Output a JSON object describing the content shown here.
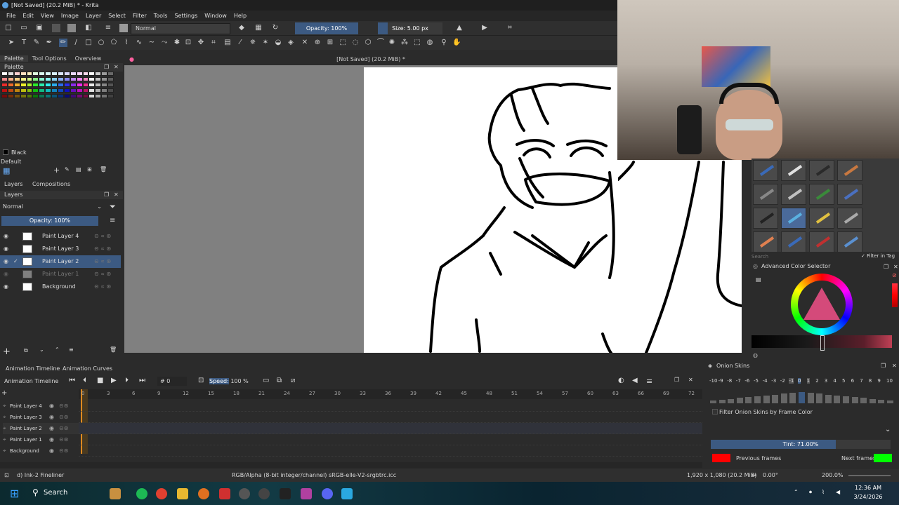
{
  "window": {
    "title": "[Not Saved]  (20.2 MiB) * - Krita"
  },
  "menu": [
    "File",
    "Edit",
    "View",
    "Image",
    "Layer",
    "Select",
    "Filter",
    "Tools",
    "Settings",
    "Window",
    "Help"
  ],
  "toolbar": {
    "blend_mode": "Normal",
    "opacity": "Opacity: 100%",
    "size": "Size: 5.00 px"
  },
  "dock_tabs": [
    "Palette",
    "Tool Options",
    "Overview"
  ],
  "palette": {
    "title": "Palette",
    "color_name": "Black",
    "palette_name": "Default"
  },
  "layers_tabs": [
    "Layers",
    "Compositions"
  ],
  "layers": {
    "blend": "Normal",
    "opacity": "Opacity:  100%",
    "items": [
      {
        "name": "Paint Layer 4",
        "visible": true,
        "selected": false
      },
      {
        "name": "Paint Layer 3",
        "visible": true,
        "selected": false
      },
      {
        "name": "Paint Layer 2",
        "visible": true,
        "selected": true
      },
      {
        "name": "Paint Layer 1",
        "visible": false,
        "selected": false
      },
      {
        "name": "Background",
        "visible": true,
        "selected": false
      }
    ]
  },
  "canvas": {
    "tab_title": "[Not Saved]  (20.2 MiB) *"
  },
  "brush": {
    "search_placeholder": "Search",
    "filter_label": "Filter in Tag"
  },
  "color_selector": {
    "title": "Advanced Color Selector"
  },
  "timeline": {
    "tabs": [
      "Animation Timeline",
      "Animation Curves"
    ],
    "title": "Animation Timeline",
    "frame": "0",
    "speed_label": "Speed:",
    "speed_value": "100 %",
    "frames": [
      "0",
      "3",
      "6",
      "9",
      "12",
      "15",
      "18",
      "21",
      "24",
      "27",
      "30",
      "33",
      "36",
      "39",
      "42",
      "45",
      "48",
      "51",
      "54",
      "57",
      "60",
      "63",
      "66",
      "69",
      "72"
    ],
    "layers": [
      "Paint Layer 4",
      "Paint Layer 3",
      "Paint Layer 2",
      "Paint Layer 1",
      "Background"
    ]
  },
  "onion": {
    "title": "Onion Skins",
    "numbers": [
      "-10",
      "-9",
      "-8",
      "-7",
      "-6",
      "-5",
      "-4",
      "-3",
      "-2",
      "-1",
      "0",
      "1",
      "2",
      "3",
      "4",
      "5",
      "6",
      "7",
      "8",
      "9",
      "10"
    ],
    "filter_label": "Filter Onion Skins by Frame Color",
    "tint": "Tint: 71.00%",
    "previous": "Previous frames",
    "next": "Next frames",
    "prev_color": "#ff0000",
    "next_color": "#00ff00"
  },
  "status": {
    "brush": "d) Ink-2 Fineliner",
    "color_space": "RGB/Alpha (8-bit integer/channel)  sRGB-elle-V2-srgbtrc.icc",
    "dimensions": "1,920 x 1,080 (20.2 MiB)",
    "rotation": "0.00°",
    "zoom": "200.0%"
  },
  "taskbar": {
    "search": "Search",
    "time": "12:36 AM",
    "date": "3/24/2026"
  }
}
